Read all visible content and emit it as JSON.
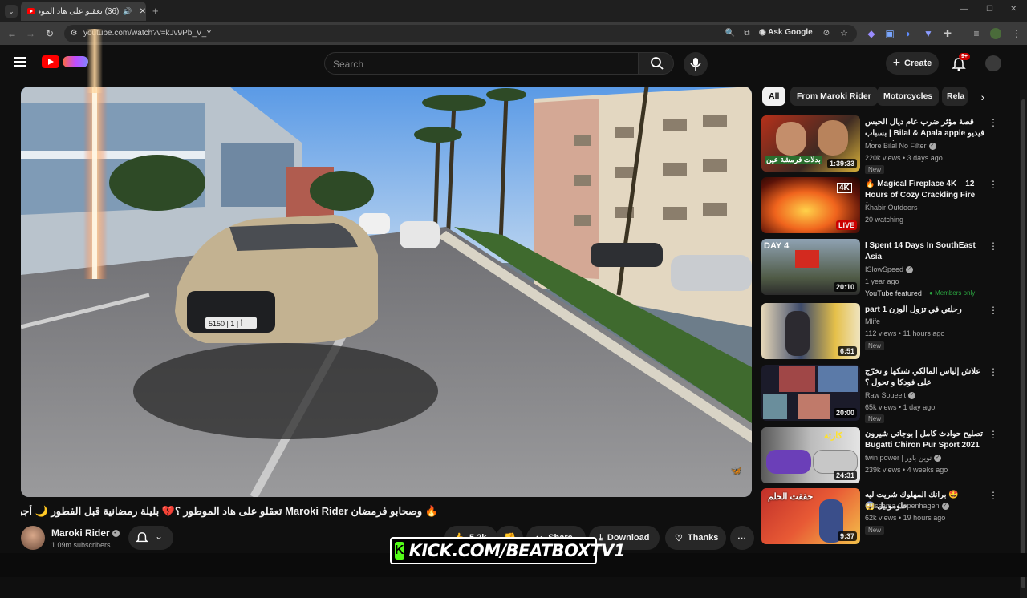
{
  "browser": {
    "tab_count_title": "(36) تعقلو على هاد الموطور",
    "url": "youtube.com/watch?v=kJv9Pb_V_Y",
    "ask_google": "Ask Google"
  },
  "header": {
    "search_placeholder": "Search",
    "create_label": "Create",
    "notifications_badge": "9+"
  },
  "video": {
    "title": "🔥 وصحابو فرمضان Maroki Rider تعقلو على هاد الموطور ؟💔 بليلة رمضانية قبل الفطور 🌙 أجواء",
    "channel": "Maroki Rider",
    "subscribers": "1.09m subscribers",
    "likes": "5.2k",
    "share_label": "Share",
    "download_label": "Download",
    "thanks_label": "Thanks",
    "plate": "5150 | أ | 1"
  },
  "chips": [
    "All",
    "From Maroki Rider",
    "Motorcycles",
    "Rela"
  ],
  "recommendations": [
    {
      "title": "قصة مؤثر ضرب عام ديال الحبس بسباب | Bilal & Apala apple فيديو فإنستغرام",
      "channel": "More Bilal No Filter",
      "meta": "220k views • 3 days ago",
      "badge": "New",
      "duration": "1:39:33",
      "thumb_text": "بدلات فرمشة عين"
    },
    {
      "title": "🔥 Magical Fireplace 4K – 12 Hours of Cozy Crackling Fire f...",
      "channel": "Khabir Outdoors",
      "meta": "20 watching",
      "badge": "",
      "duration": "LIVE",
      "thumb_text": "4K"
    },
    {
      "title": "I Spent 14 Days In SouthEast Asia",
      "channel": "ISlowSpeed",
      "meta": "1 year ago",
      "badge": "YouTube featured",
      "members": "Members only",
      "duration": "20:10",
      "thumb_text": "DAY 4"
    },
    {
      "title": "رحلتي في تزول الوزن part 1",
      "channel": "Mlife",
      "meta": "112 views • 11 hours ago",
      "badge": "New",
      "duration": "6:51",
      "thumb_text": ""
    },
    {
      "title": "علاش إلياس المالكي شنكها و تخرّج على فودكا و تحول ؟",
      "channel": "Raw Soueelt",
      "meta": "65k views • 1 day ago",
      "badge": "New",
      "duration": "20:00",
      "thumb_text": ""
    },
    {
      "title": "تصليح حوادث كامل | بوجاتي شيرون Bugatti Chiron Pur Sport 2021",
      "channel": "twin power | توين باور",
      "meta": "239k views • 4 weeks ago",
      "badge": "",
      "duration": "24:31",
      "thumb_text": "كارثة"
    },
    {
      "title": "🤩 برانك المهلوك شريت ليه طوموبيل 😱",
      "channel": "Oussama Copenhagen",
      "meta": "62k views • 19 hours ago",
      "badge": "New",
      "duration": "9:37",
      "thumb_text": "حققت الحلم"
    }
  ],
  "overlay": {
    "kick_text": "KICK.COM/BEATBOXTV1"
  }
}
